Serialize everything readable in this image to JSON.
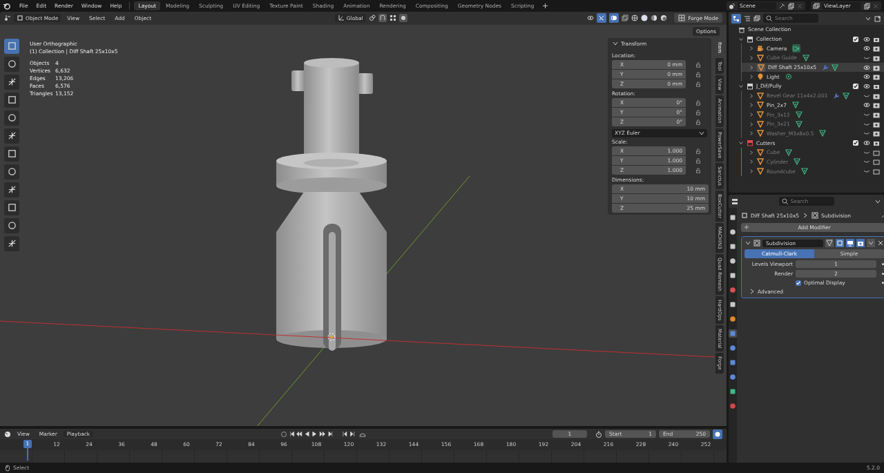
{
  "menu": [
    "File",
    "Edit",
    "Render",
    "Window",
    "Help"
  ],
  "workspaces": [
    {
      "label": "Layout",
      "selected": true
    },
    {
      "label": "Modeling",
      "selected": false
    },
    {
      "label": "Sculpting",
      "selected": false
    },
    {
      "label": "UV Editing",
      "selected": false
    },
    {
      "label": "Texture Paint",
      "selected": false
    },
    {
      "label": "Shading",
      "selected": false
    },
    {
      "label": "Animation",
      "selected": false
    },
    {
      "label": "Rendering",
      "selected": false
    },
    {
      "label": "Compositing",
      "selected": false
    },
    {
      "label": "Geometry Nodes",
      "selected": false
    },
    {
      "label": "Scripting",
      "selected": false
    }
  ],
  "scene": "Scene",
  "view_layer": "ViewLayer",
  "header": {
    "mode": "Object Mode",
    "menus": [
      "View",
      "Select",
      "Add",
      "Object"
    ],
    "orientation": "Global",
    "custom_mode": "Forge Mode",
    "options": "Options"
  },
  "viewport": {
    "view_name": "User Orthographic",
    "context": "(1) Collection | Diff Shaft 25x10x5",
    "stats": [
      {
        "label": "Objects",
        "value": "4"
      },
      {
        "label": "Vertices",
        "value": "6,632"
      },
      {
        "label": "Edges",
        "value": "13,206"
      },
      {
        "label": "Faces",
        "value": "6,576"
      },
      {
        "label": "Triangles",
        "value": "13,152"
      }
    ]
  },
  "transform": {
    "title": "Transform",
    "groups": [
      {
        "label": "Location:",
        "locked": true,
        "rows": [
          {
            "axis": "X",
            "value": "0 mm"
          },
          {
            "axis": "Y",
            "value": "0 mm"
          },
          {
            "axis": "Z",
            "value": "0 mm"
          }
        ]
      },
      {
        "label": "Rotation:",
        "locked": true,
        "rows": [
          {
            "axis": "X",
            "value": "0°"
          },
          {
            "axis": "Y",
            "value": "0°"
          },
          {
            "axis": "Z",
            "value": "0°"
          }
        ],
        "mode": "XYZ Euler"
      },
      {
        "label": "Scale:",
        "locked": true,
        "rows": [
          {
            "axis": "X",
            "value": "1.000"
          },
          {
            "axis": "Y",
            "value": "1.000"
          },
          {
            "axis": "Z",
            "value": "1.000"
          }
        ]
      },
      {
        "label": "Dimensions:",
        "locked": false,
        "rows": [
          {
            "axis": "X",
            "value": "10 mm"
          },
          {
            "axis": "Y",
            "value": "10 mm"
          },
          {
            "axis": "Z",
            "value": "25 mm"
          }
        ]
      }
    ]
  },
  "side_tabs": [
    {
      "label": "Item",
      "selected": true
    },
    {
      "label": "Tool",
      "selected": false
    },
    {
      "label": "View",
      "selected": false
    },
    {
      "label": "Animation",
      "selected": false
    },
    {
      "label": "PowerSave",
      "selected": false
    },
    {
      "label": "Sanctus",
      "selected": false
    },
    {
      "label": "BoxCutter",
      "selected": false
    },
    {
      "label": "MACHIN3",
      "selected": false
    },
    {
      "label": "Quad Remesh",
      "selected": false
    },
    {
      "label": "HardOps",
      "selected": false
    },
    {
      "label": "Material",
      "selected": false
    },
    {
      "label": "Forge",
      "selected": false
    }
  ],
  "outliner": {
    "search_placeholder": "Search",
    "root": "Scene Collection",
    "collections": [
      {
        "name": "Collection",
        "checked": true,
        "color": "#d0d0d0",
        "children": [
          {
            "name": "Camera",
            "kind": "camera",
            "dim": false,
            "visible": true,
            "selected": false,
            "modifier": false
          },
          {
            "name": "Cube Guide",
            "kind": "mesh",
            "dim": true,
            "visible": false,
            "selected": false,
            "modifier": false
          },
          {
            "name": "Diff Shaft 25x10x5",
            "kind": "mesh",
            "dim": false,
            "visible": true,
            "selected": true,
            "modifier": true
          },
          {
            "name": "Light",
            "kind": "light",
            "dim": false,
            "visible": true,
            "selected": false,
            "modifier": false
          }
        ]
      },
      {
        "name": "J_Dif/Pully",
        "checked": true,
        "color": "#d0d0d0",
        "children": [
          {
            "name": "Bevel Gear 11x4x2.001",
            "kind": "mesh",
            "dim": true,
            "visible": false,
            "selected": false,
            "modifier": true
          },
          {
            "name": "Pin_2x7",
            "kind": "mesh",
            "dim": false,
            "visible": true,
            "selected": false,
            "modifier": false
          },
          {
            "name": "Pin_3x12",
            "kind": "mesh",
            "dim": true,
            "visible": false,
            "selected": false,
            "modifier": false
          },
          {
            "name": "Pin_3x21",
            "kind": "mesh",
            "dim": true,
            "visible": false,
            "selected": false,
            "modifier": false
          },
          {
            "name": "Washer_M3x8x0.5",
            "kind": "mesh",
            "dim": true,
            "visible": false,
            "selected": false,
            "modifier": false
          }
        ]
      },
      {
        "name": "Cutters",
        "checked": true,
        "color": "#e04848",
        "children": [
          {
            "name": "Cube",
            "kind": "mesh",
            "dim": true,
            "visible": false,
            "selected": false,
            "modifier": false
          },
          {
            "name": "Cylinder",
            "kind": "mesh",
            "dim": true,
            "visible": false,
            "selected": false,
            "modifier": false
          },
          {
            "name": "Roundcube",
            "kind": "mesh",
            "dim": true,
            "visible": false,
            "selected": false,
            "modifier": false
          }
        ]
      }
    ]
  },
  "properties": {
    "search_placeholder": "Search",
    "object": "Diff Shaft 25x10x5",
    "modifier_name": "Subdivision",
    "add_modifier": "Add Modifier",
    "modifier": {
      "name": "Subdivision",
      "expanded": true,
      "types": [
        {
          "label": "Catmull-Clark",
          "selected": true
        },
        {
          "label": "Simple",
          "selected": false
        }
      ],
      "fields": [
        {
          "label": "Levels Viewport",
          "value": "1"
        },
        {
          "label": "Render",
          "value": "2"
        }
      ],
      "optimal_display": {
        "label": "Optimal Display",
        "checked": true
      },
      "advanced": "Advanced"
    }
  },
  "timeline": {
    "menus": [
      "View",
      "Marker"
    ],
    "playback": "Playback",
    "current_frame": "1",
    "start_label": "Start",
    "start": "1",
    "end_label": "End",
    "end": "250",
    "playhead": "1",
    "ticks": [
      "12",
      "24",
      "36",
      "48",
      "60",
      "72",
      "84",
      "96",
      "108",
      "120",
      "132",
      "144",
      "156",
      "168",
      "180",
      "192",
      "204",
      "216",
      "228",
      "240",
      "252"
    ]
  },
  "status": {
    "hint": "Select",
    "version": "5.2.0"
  }
}
